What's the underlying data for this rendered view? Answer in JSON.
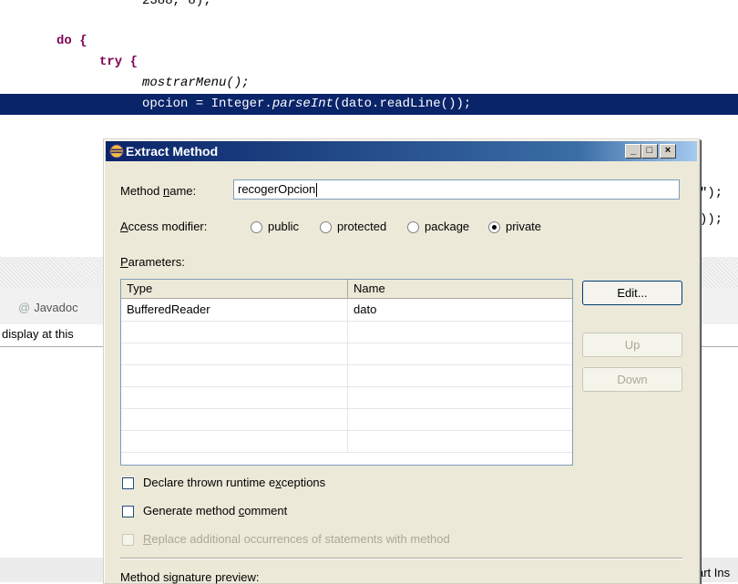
{
  "editor": {
    "line_cut": "2388, 8);",
    "line_do": "do {",
    "line_try": "try {",
    "line_menu": "mostrarMenu();",
    "line_selected_prefix": "opcion = Integer.",
    "line_selected_method": "parseInt",
    "line_selected_suffix": "(dato.readLine());",
    "side_snip_1": "\");",
    "side_snip_2": "));"
  },
  "views": {
    "javadoc_tab": "Javadoc",
    "content_text": "display at this",
    "bottom_text": "art Ins"
  },
  "dialog": {
    "title": "Extract Method",
    "method_name_label_pre": "Method ",
    "method_name_label_u": "n",
    "method_name_label_post": "ame:",
    "method_name_value": "recogerOpcion",
    "access_label_u": "A",
    "access_label_post": "ccess modifier:",
    "modifiers": [
      "public",
      "protected",
      "package",
      "private"
    ],
    "selected_modifier": "private",
    "parameters_label_u": "P",
    "parameters_label_post": "arameters:",
    "columns": [
      "Type",
      "Name"
    ],
    "rows": [
      {
        "type": "BufferedReader",
        "name": "dato"
      }
    ],
    "edit_button": "Edit...",
    "up_button": "Up",
    "down_button": "Down",
    "check_declare_pre": "Declare thrown runtime e",
    "check_declare_u": "x",
    "check_declare_post": "ceptions",
    "check_comment_pre": "Generate method ",
    "check_comment_u": "c",
    "check_comment_post": "omment",
    "check_replace_u": "R",
    "check_replace_post": "eplace additional occurrences of statements with method",
    "signature_label": "Method signature preview:"
  },
  "colors": {
    "selection": "#0a246a",
    "dialog_bg": "#ece9d8",
    "keyword": "#7f0055"
  }
}
